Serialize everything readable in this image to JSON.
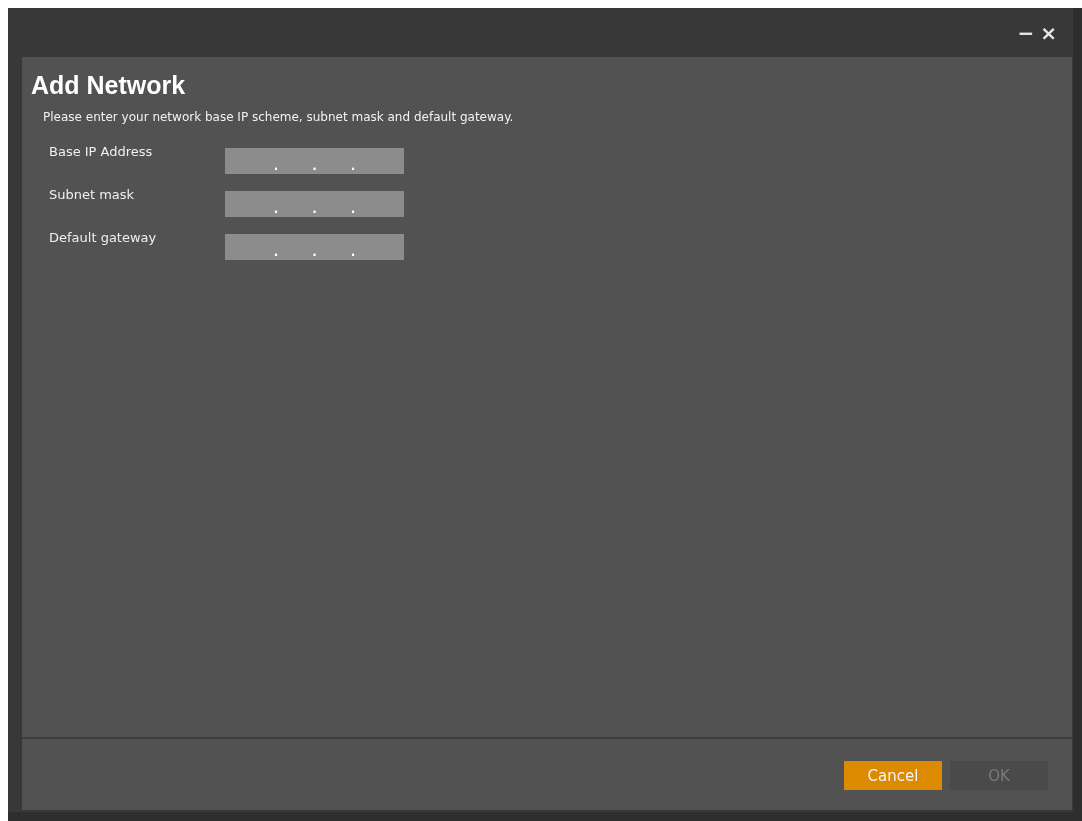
{
  "window": {
    "controls": [
      "−",
      "×"
    ]
  },
  "title": "Add Network",
  "instructions": "Please enter your network base IP scheme, subnet mask and default gateway.",
  "fields": [
    {
      "label": "Base IP Address",
      "separators": [
        ".",
        ".",
        "."
      ]
    },
    {
      "label": "Subnet mask",
      "separators": [
        ".",
        ".",
        "."
      ]
    },
    {
      "label": "Default gateway",
      "separators": [
        ".",
        ".",
        "."
      ]
    }
  ],
  "buttons": [
    {
      "label": "Cancel",
      "highlighted": true,
      "disabled": false
    },
    {
      "label": "OK",
      "highlighted": false,
      "disabled": true
    }
  ]
}
